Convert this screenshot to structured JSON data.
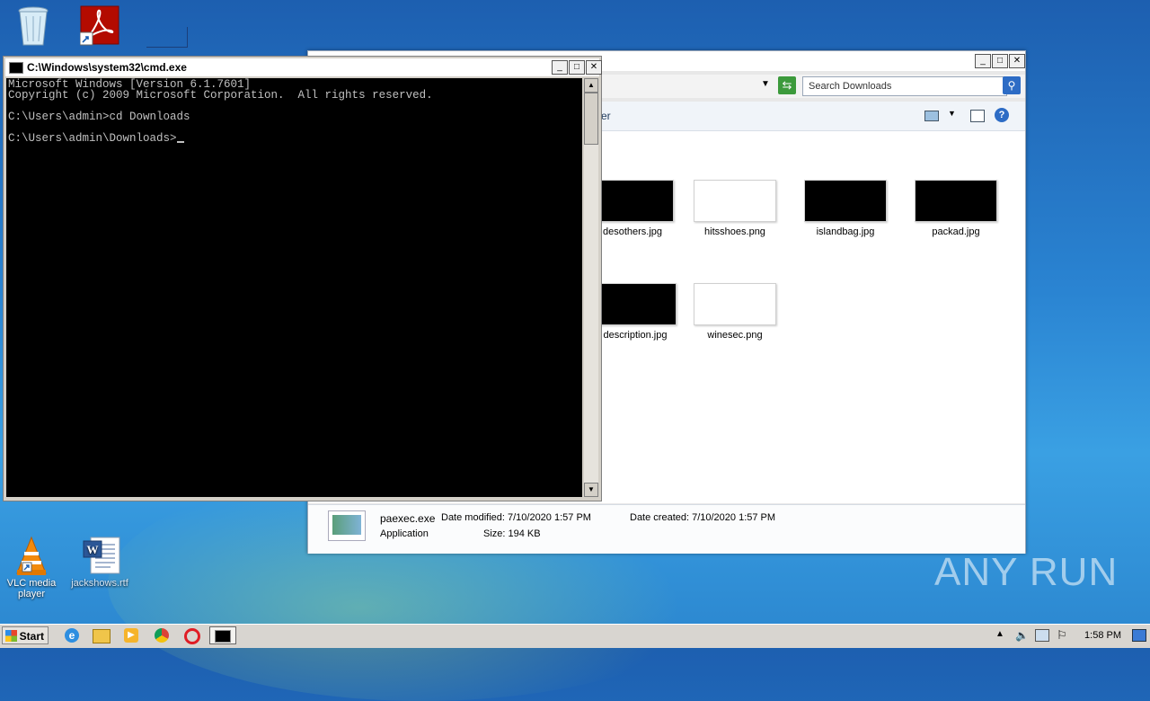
{
  "desktop": {
    "icons": [
      {
        "label": "",
        "icon": "recycle-bin"
      },
      {
        "label": "",
        "icon": "acrobat-reader"
      },
      {
        "label": "VLC media player",
        "icon": "vlc"
      },
      {
        "label": "jackshows.rtf",
        "icon": "word-document"
      }
    ]
  },
  "explorer": {
    "search_placeholder": "Search Downloads",
    "toolbar_partial": "er",
    "files": [
      {
        "name": "desothers.jpg",
        "thumb_color": "#000000"
      },
      {
        "name": "hitsshoes.png",
        "thumb_color": "#ffffff"
      },
      {
        "name": "islandbag.jpg",
        "thumb_color": "#000000"
      },
      {
        "name": "packad.jpg",
        "thumb_color": "#000000"
      },
      {
        "name": "description.jpg",
        "thumb_color": "#000000"
      },
      {
        "name": "winesec.png",
        "thumb_color": "#ffffff"
      }
    ],
    "details": {
      "filename": "paexec.exe",
      "type": "Application",
      "date_modified": "Date modified: 7/10/2020 1:57 PM",
      "size": "Size: 194 KB",
      "date_created": "Date created: 7/10/2020 1:57 PM"
    }
  },
  "cmd": {
    "title": "C:\\Windows\\system32\\cmd.exe",
    "lines": [
      "Microsoft Windows [Version 6.1.7601]",
      "Copyright (c) 2009 Microsoft Corporation.  All rights reserved.",
      "",
      "C:\\Users\\admin>cd Downloads",
      "",
      "C:\\Users\\admin\\Downloads>"
    ]
  },
  "taskbar": {
    "start_label": "Start",
    "clock": "1:58 PM",
    "items": [
      "ie-icon",
      "explorer-icon",
      "media-player-icon",
      "chrome-icon",
      "opera-icon",
      "cmd-icon"
    ]
  },
  "watermark": "ANY RUN"
}
